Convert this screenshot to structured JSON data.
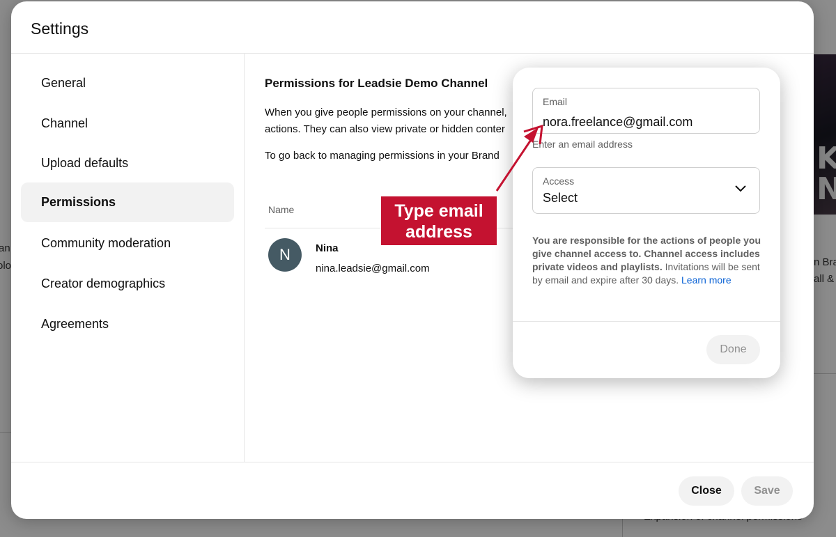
{
  "background": {
    "thumb_letters": [
      "K",
      "N"
    ],
    "left_fragments": [
      "an",
      "olo"
    ],
    "right_fragments": [
      "n Bra",
      "all &"
    ],
    "bottom_text": "Expansion of channel permissions"
  },
  "dialog": {
    "title": "Settings",
    "nav": [
      {
        "label": "General",
        "active": false
      },
      {
        "label": "Channel",
        "active": false
      },
      {
        "label": "Upload defaults",
        "active": false
      },
      {
        "label": "Permissions",
        "active": true
      },
      {
        "label": "Community moderation",
        "active": false
      },
      {
        "label": "Creator demographics",
        "active": false
      },
      {
        "label": "Agreements",
        "active": false
      }
    ],
    "content": {
      "title": "Permissions for Leadsie Demo Channel",
      "desc_line1": "When you give people permissions on your channel,",
      "desc_line2": "actions. They can also view private or hidden conter",
      "desc_line3": "To go back to managing permissions in your Brand",
      "column_name": "Name",
      "user": {
        "initial": "N",
        "name": "Nina",
        "email": "nina.leadsie@gmail.com"
      }
    },
    "footer": {
      "close_label": "Close",
      "save_label": "Save"
    }
  },
  "invite": {
    "email_label": "Email",
    "email_value": "nora.freelance@gmail.com",
    "email_helper": "Enter an email address",
    "access_label": "Access",
    "access_value": "Select",
    "notice_bold": "You are responsible for the actions of people you give channel access to. Channel access includes private videos and playlists.",
    "notice_text": " Invitations will be sent by email and expire after 30 days. ",
    "notice_link": "Learn more",
    "done_label": "Done"
  },
  "annotation": {
    "text_line1": "Type email",
    "text_line2": "address",
    "color": "#c41230"
  },
  "colors": {
    "link": "#065fd4",
    "avatar": "#455a64",
    "active_nav_bg": "#f2f2f2"
  }
}
